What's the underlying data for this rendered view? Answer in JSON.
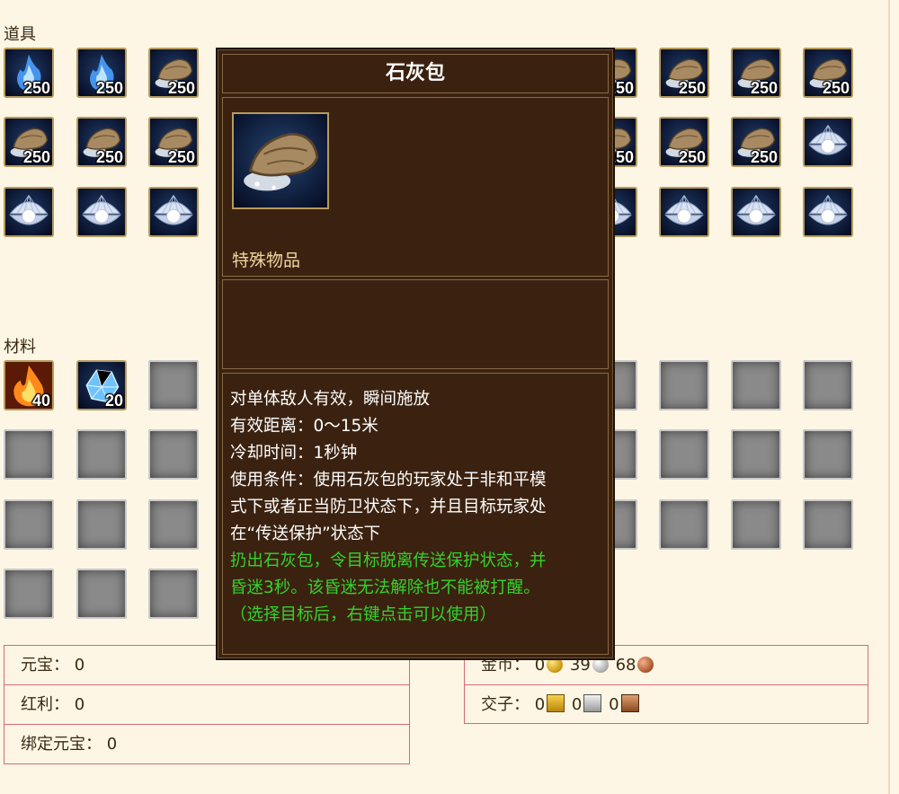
{
  "sections": {
    "items_label": "道具",
    "materials_label": "材料"
  },
  "item_slots": [
    {
      "icon": "blue-flame-icon",
      "count": "250"
    },
    {
      "icon": "blue-flame-icon",
      "count": "250"
    },
    {
      "icon": "lime-bag-icon",
      "count": "250"
    },
    {
      "icon": "lime-bag-icon",
      "count": "250"
    },
    {
      "icon": "lime-bag-icon",
      "count": "250"
    },
    {
      "icon": "lime-bag-icon",
      "count": "250"
    },
    {
      "icon": "lime-bag-icon",
      "count": "250"
    },
    {
      "icon": "lime-bag-icon",
      "count": "250"
    },
    {
      "icon": "lime-bag-icon",
      "count": "250"
    },
    {
      "icon": "lime-bag-icon",
      "count": "250"
    },
    {
      "icon": "lime-bag-icon",
      "count": "250"
    },
    {
      "icon": "lime-bag-icon",
      "count": "250"
    },
    {
      "icon": "lime-bag-icon",
      "count": "250"
    },
    {
      "icon": "lime-bag-icon",
      "count": "250"
    },
    {
      "icon": "lime-bag-icon",
      "count": "250"
    },
    {
      "icon": "pearl-shell-icon",
      "count": ""
    },
    {
      "icon": "pearl-shell-icon",
      "count": ""
    },
    {
      "icon": "pearl-shell-icon",
      "count": ""
    },
    {
      "icon": "pearl-shell-icon",
      "count": ""
    },
    {
      "icon": "pearl-shell-icon",
      "count": ""
    },
    {
      "icon": "pearl-shell-icon",
      "count": ""
    },
    {
      "icon": "pearl-shell-icon",
      "count": ""
    },
    {
      "icon": "pearl-shell-icon",
      "count": ""
    },
    {
      "icon": "pearl-shell-icon",
      "count": ""
    }
  ],
  "material_slots": [
    {
      "icon": "fire-material-icon",
      "count": "40"
    },
    {
      "icon": "ice-crystal-icon",
      "count": "20"
    }
  ],
  "currency_left": {
    "yuanbao": "元宝： 0",
    "hongli": "红利： 0",
    "bound_yuanbao": "绑定元宝： 0"
  },
  "currency_right": {
    "gold_label": "金币：",
    "gold": "0",
    "silver": "39",
    "copper": "68",
    "jiaozi_label": "交子：",
    "jiaozi_gold": "0",
    "jiaozi_silver": "0",
    "jiaozi_copper": "0"
  },
  "tooltip": {
    "title": "石灰包",
    "type": "特殊物品",
    "desc_lines": [
      "对单体敌人有效，瞬间施放",
      "有效距离：0～15米",
      "冷却时间：1秒钟",
      "使用条件：使用石灰包的玩家处于非和平模",
      "式下或者正当防卫状态下，并且目标玩家处",
      "在“传送保护”状态下"
    ],
    "effect_lines": [
      "扔出石灰包，令目标脱离传送保护状态，并",
      "昏迷3秒。该昏迷无法解除也不能被打醒。",
      "（选择目标后，右键点击可以使用）"
    ]
  },
  "colors": {
    "tooltip_bg": "#3b2210",
    "effect_text": "#34d22e",
    "type_text": "#f0d7a0",
    "panel_border": "#d46a7a"
  }
}
